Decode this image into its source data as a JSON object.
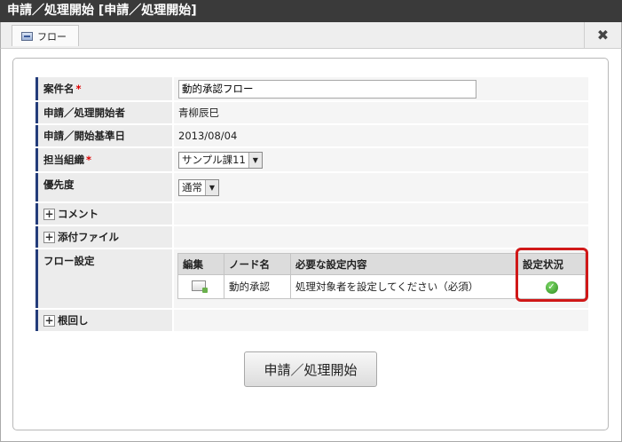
{
  "window": {
    "title": "申請／処理開始 [申請／処理開始]"
  },
  "tab": {
    "label": "フロー",
    "close_symbol": "✖"
  },
  "form": {
    "rows": [
      {
        "label": "案件名",
        "required": true,
        "value": "動的承認フロー"
      },
      {
        "label": "申請／処理開始者",
        "value": "青柳辰巳"
      },
      {
        "label": "申請／開始基準日",
        "value": "2013/08/04"
      },
      {
        "label": "担当組織",
        "required": true,
        "value": "サンプル課11"
      },
      {
        "label": "優先度",
        "value": "通常"
      },
      {
        "label": "コメント"
      },
      {
        "label": "添付ファイル"
      },
      {
        "label": "フロー設定"
      },
      {
        "label": "根回し"
      }
    ],
    "required_mark": "*",
    "expand_symbol": "+",
    "dropdown_arrow": "▼"
  },
  "flow_table": {
    "headers": [
      "編集",
      "ノード名",
      "必要な設定内容",
      "設定状況"
    ],
    "rows": [
      {
        "node": "動的承認",
        "requirement": "処理対象者を設定してください（必須）",
        "status_icon": "check-icon"
      }
    ]
  },
  "actions": {
    "submit_label": "申請／処理開始"
  },
  "colors": {
    "accent": "#233c7a",
    "highlight": "#d01818",
    "titlebar": "#3a3a3a"
  }
}
